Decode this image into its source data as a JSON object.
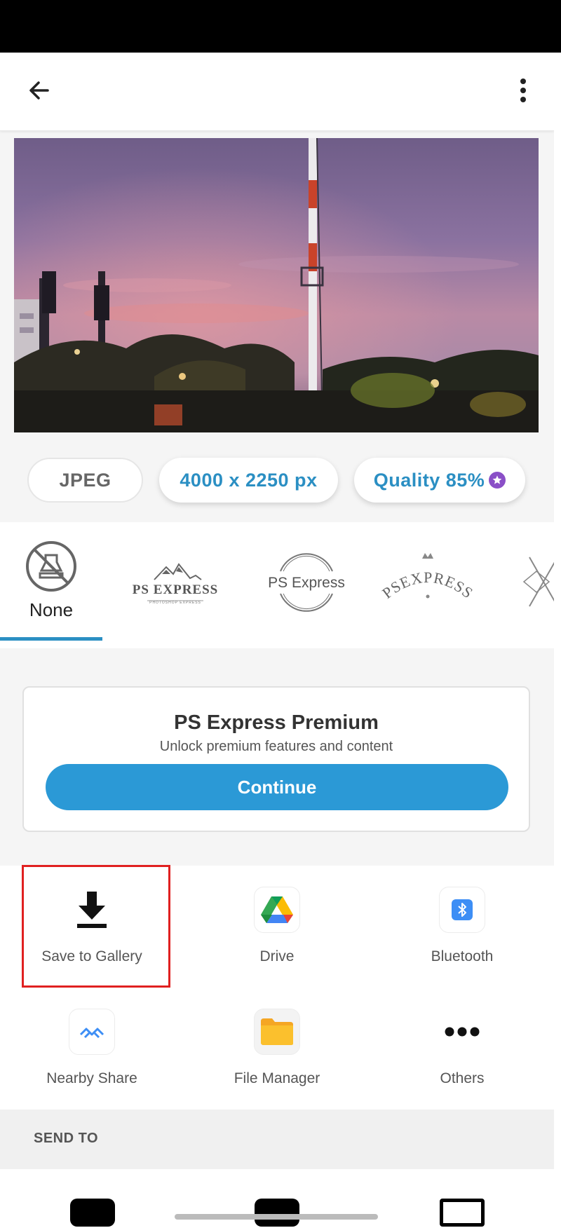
{
  "export_options": {
    "format": "JPEG",
    "dimensions": "4000 x 2250 px",
    "quality": "Quality 85%"
  },
  "watermarks": {
    "none_label": "None",
    "items": [
      "PS EXPRESS",
      "PHOTOSHOP EXPRESS",
      "PS Express",
      "PSEXPRESS"
    ]
  },
  "premium": {
    "title": "PS Express Premium",
    "subtitle": "Unlock premium features and content",
    "cta": "Continue"
  },
  "share_targets": [
    {
      "label": "Save to Gallery",
      "icon": "download-icon"
    },
    {
      "label": "Drive",
      "icon": "google-drive-icon"
    },
    {
      "label": "Bluetooth",
      "icon": "bluetooth-icon"
    },
    {
      "label": "Nearby Share",
      "icon": "nearby-share-icon"
    },
    {
      "label": "File Manager",
      "icon": "folder-icon"
    },
    {
      "label": "Others",
      "icon": "more-horizontal-icon"
    }
  ],
  "send_to": {
    "label": "SEND TO"
  },
  "colors": {
    "accent": "#2b99d6",
    "accent_text": "#2b8fc3",
    "premium_badge": "#8a4fc7",
    "highlight": "#e02020"
  }
}
